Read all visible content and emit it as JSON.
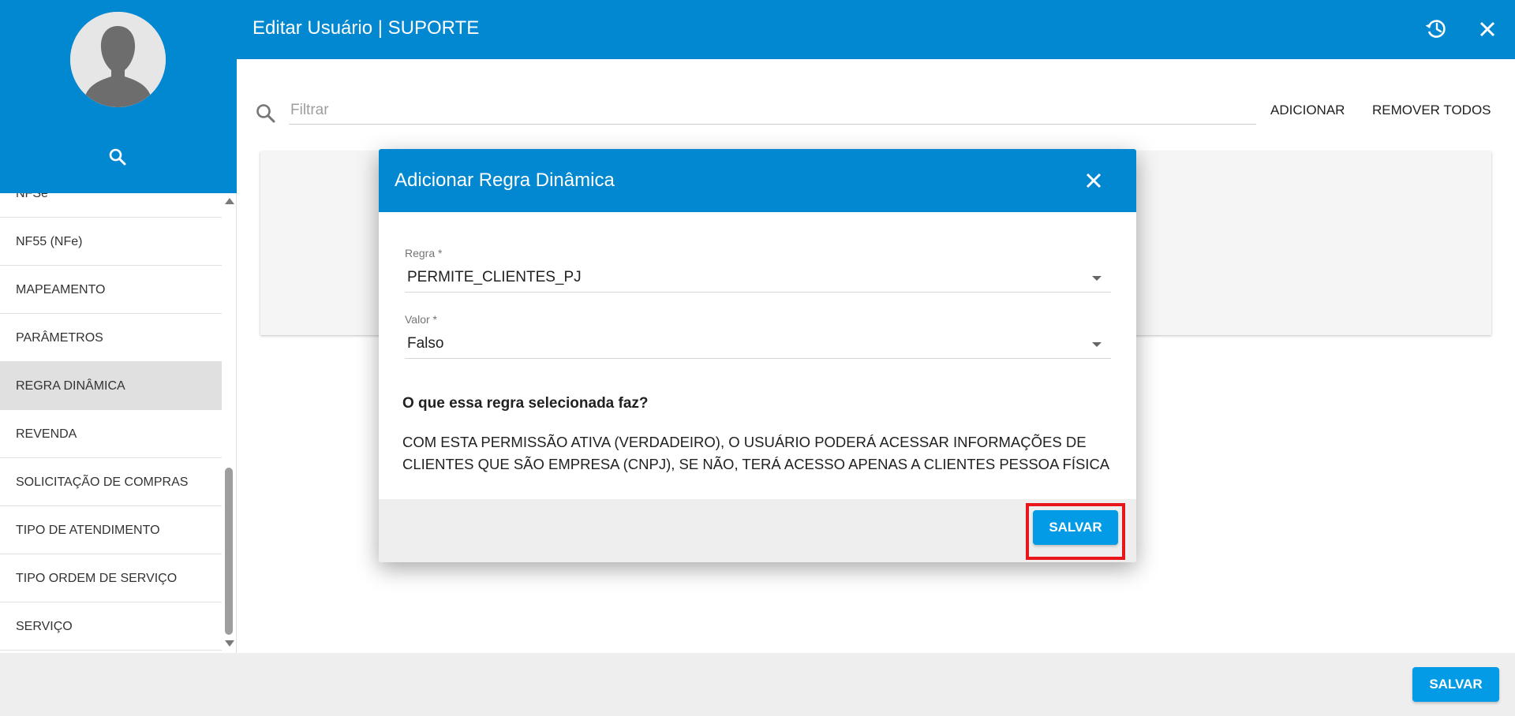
{
  "header": {
    "title": "Editar Usuário | SUPORTE",
    "history_icon": "history-icon",
    "close_icon": "close-icon"
  },
  "sidebar": {
    "avatar_icon": "person-silhouette-icon",
    "search_icon": "search-icon",
    "items": [
      {
        "label": "NFSe",
        "active": false
      },
      {
        "label": "NF55 (NFe)",
        "active": false
      },
      {
        "label": "MAPEAMENTO",
        "active": false
      },
      {
        "label": "PARÂMETROS",
        "active": false
      },
      {
        "label": "REGRA DINÂMICA",
        "active": true
      },
      {
        "label": "REVENDA",
        "active": false
      },
      {
        "label": "SOLICITAÇÃO DE COMPRAS",
        "active": false
      },
      {
        "label": "TIPO DE ATENDIMENTO",
        "active": false
      },
      {
        "label": "TIPO ORDEM DE SERVIÇO",
        "active": false
      },
      {
        "label": "SERVIÇO",
        "active": false
      }
    ]
  },
  "main": {
    "filter_placeholder": "Filtrar",
    "filter_value": "",
    "add_label": "ADICIONAR",
    "remove_all_label": "REMOVER TODOS"
  },
  "dialog": {
    "title": "Adicionar Regra Dinâmica",
    "rule_label": "Regra *",
    "rule_value": "PERMITE_CLIENTES_PJ",
    "value_label": "Valor *",
    "value_value": "Falso",
    "question": "O que essa regra selecionada faz?",
    "description": "COM ESTA PERMISSÃO ATIVA (VERDADEIRO), O USUÁRIO PODERÁ ACESSAR INFORMAÇÕES DE CLIENTES QUE SÃO EMPRESA (CNPJ), SE NÃO, TERÁ ACESSO APENAS A CLIENTES PESSOA FÍSICA",
    "save_label": "SALVAR"
  },
  "footer": {
    "save_label": "SALVAR"
  },
  "colors": {
    "primary": "#0288d1",
    "button": "#039be5",
    "highlight": "#e8151b",
    "active_item": "#e0e0e0"
  }
}
